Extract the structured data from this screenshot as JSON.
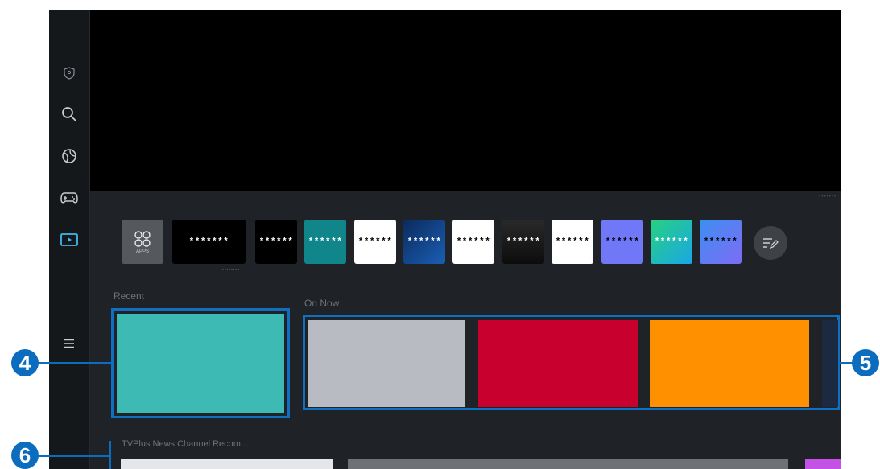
{
  "sidebar": {
    "icons": [
      "shield-icon",
      "search-icon",
      "ambient-icon",
      "gamepad-icon",
      "media-icon",
      "menu-icon"
    ]
  },
  "hero": {
    "page_indicator": "•••••••"
  },
  "apps_row": {
    "apps_button_label": "APPS",
    "under_mark": "••••••••",
    "tiles": [
      {
        "label": "*******",
        "bg": "#000000",
        "fg": "#ffffff"
      },
      {
        "label": "******",
        "bg": "#000000",
        "fg": "#ffffff"
      },
      {
        "label": "******",
        "bg": "#11868a",
        "fg": "#ffffff"
      },
      {
        "label": "******",
        "bg": "#ffffff",
        "fg": "#000000"
      },
      {
        "label": "******",
        "bg": "#0f3b7a",
        "fg": "#ffffff"
      },
      {
        "label": "******",
        "bg": "#ffffff",
        "fg": "#000000"
      },
      {
        "label": "******",
        "bg": "#1a1a1a",
        "fg": "#ffffff"
      },
      {
        "label": "******",
        "bg": "#ffffff",
        "fg": "#000000"
      },
      {
        "label": "******",
        "bg": "#7178f7",
        "fg": "#000000"
      },
      {
        "label": "******",
        "bg": "#22c4b4",
        "fg": "#ffffff"
      },
      {
        "label": "******",
        "bg": "#4f7df2",
        "fg": "#000000"
      }
    ]
  },
  "recent": {
    "title": "Recent",
    "card_color": "#3dbab3"
  },
  "on_now": {
    "title": "On Now",
    "cards": [
      {
        "color": "#b8bcc2"
      },
      {
        "color": "#c8002d"
      },
      {
        "color": "#ff9000"
      },
      {
        "color": "#1b2a40"
      }
    ]
  },
  "news": {
    "title": "TVPlus News Channel Recom...",
    "cards": [
      {
        "color": "#e4e6ea"
      },
      {
        "color": "#6e7276"
      },
      {
        "color": "#c552e6"
      }
    ]
  },
  "callouts": {
    "c4": "4",
    "c5": "5",
    "c6": "6"
  },
  "colors": {
    "accent": "#0c6cbd",
    "screen_bg": "#1f2226",
    "hero_bg": "#000000"
  }
}
